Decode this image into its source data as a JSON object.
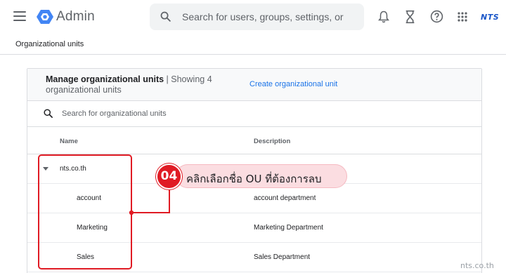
{
  "header": {
    "app_title": "Admin",
    "search_placeholder": "Search for users, groups, settings, or",
    "brand": "NTS"
  },
  "breadcrumb": "Organizational units",
  "card": {
    "title_bold": "Manage organizational units",
    "title_rest": " | Showing 4 organizational units",
    "create_link": "Create organizational unit",
    "search_placeholder": "Search for organizational units",
    "columns": {
      "name": "Name",
      "description": "Description"
    },
    "rows": [
      {
        "name": "nts.co.th",
        "description": "",
        "expanded": true,
        "level": 0
      },
      {
        "name": "account",
        "description": "account department",
        "level": 1
      },
      {
        "name": "Marketing",
        "description": "Marketing Department",
        "level": 1
      },
      {
        "name": "Sales",
        "description": "Sales Department",
        "level": 1
      }
    ]
  },
  "annotation": {
    "step": "04",
    "text": "คลิกเลือกชื่อ OU ที่ต้องการลบ",
    "color": "#e01b24"
  },
  "watermark": "nts.co.th",
  "colors": {
    "accent": "#1a73e8",
    "logo_blue": "#4285f4",
    "highlight_red": "#e01b24"
  },
  "icons": [
    "menu-icon",
    "admin-logo-icon",
    "search-icon",
    "bell-icon",
    "hourglass-icon",
    "help-icon",
    "apps-grid-icon"
  ]
}
